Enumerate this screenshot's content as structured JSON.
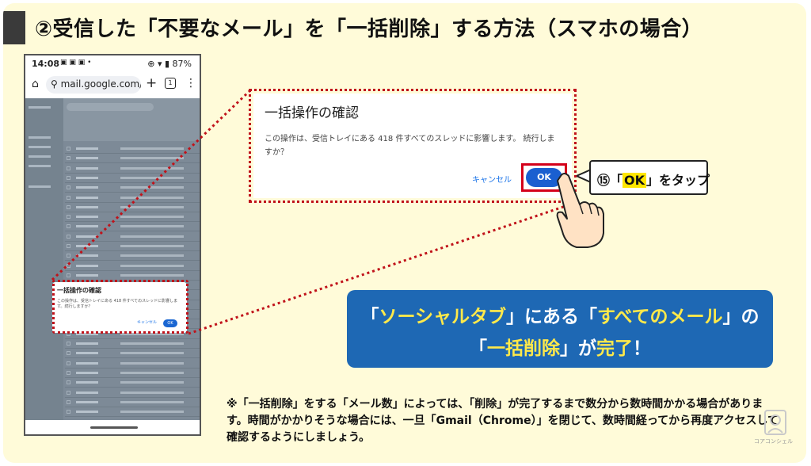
{
  "slide": {
    "title": "②受信した「不要なメール」を「一括削除」する方法（スマホの場合）"
  },
  "phone": {
    "status_time": "14:08",
    "status_battery": "87%",
    "url": "mail.google.com/",
    "tab_count": "1",
    "mini_dialog": {
      "title": "一括操作の確認",
      "body": "この操作は、受信トレイにある 418 件すべてのスレッドに影響します。続行しますか？",
      "cancel": "キャンセル",
      "ok": "OK"
    }
  },
  "dialog": {
    "title": "一括操作の確認",
    "body": "この操作は、受信トレイにある 418 件すべてのスレッドに影響します。 続行しますか？",
    "cancel_label": "キャンセル",
    "ok_label": "OK"
  },
  "callout": {
    "step": "⑮「",
    "ok": "OK",
    "suffix": "」をタップ"
  },
  "summary": {
    "l1_a": "「",
    "l1_b": "ソーシャルタブ",
    "l1_c": "」にある「",
    "l1_d": "すべてのメール",
    "l1_e": "」の",
    "l2_a": "「",
    "l2_b": "一括削除",
    "l2_c": "」が",
    "l2_d": "完了",
    "l2_e": "！"
  },
  "note": {
    "text": "※「一括削除」をする「メール数」によっては、「削除」が完了するまで数分から数時間かかる場合があります。時間がかかりそうな場合には、一旦「Gmail（Chrome）」を閉じて、数時間経ってから再度アクセスして確認するようにしましょう。"
  },
  "watermark": {
    "text": "コアコンシェル"
  },
  "colors": {
    "slide_bg": "#fffbd9",
    "accent_red": "#d4001a",
    "summary_bg": "#1e68b4",
    "highlight_yellow": "#ffe94a"
  }
}
